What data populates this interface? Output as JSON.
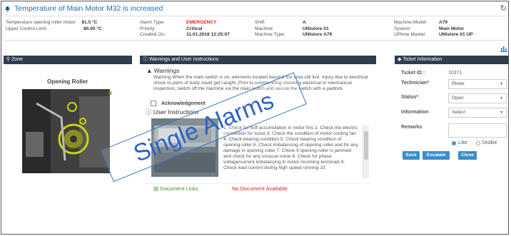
{
  "header": {
    "title": "Temperature of Main Motor M32 is increased"
  },
  "info": {
    "col1": [
      {
        "label": "Temperature opening roller motor:",
        "value": "81.5 °C"
      },
      {
        "label": "Upper Control Limit:",
        "value": "80.00  °C"
      }
    ],
    "col2": [
      {
        "label": "Alarm Type:",
        "value": "EMERGENCY"
      },
      {
        "label": "Priority:",
        "value": "Critical"
      },
      {
        "label": "Created On:",
        "value": "11.01.2018 12:25:07"
      }
    ],
    "col3": [
      {
        "label": "Shift:",
        "value": "A"
      },
      {
        "label": "Machine:",
        "value": "UNIstore 01"
      },
      {
        "label": "Machine Type:",
        "value": "UNIstore A79"
      }
    ],
    "col4": [
      {
        "label": "Machine Model:",
        "value": "A79"
      },
      {
        "label": "System:",
        "value": "Main Motor"
      },
      {
        "label": "UPtime Master:",
        "value": "UNIstore 01 UP"
      }
    ]
  },
  "panels": {
    "zone": "Zone",
    "warnings": "Warnings and User Instructions",
    "ticket": "Ticket Information"
  },
  "zone": {
    "title": "Opening Roller"
  },
  "warnings": {
    "title": "Warnings",
    "text": "Warning When the main switch is on, elements located beyond the area still live. Injury due to electrical shock or parts of body could get caught. Prior to commencing checking electrical or mechanical inspection, switch off the machine via the main switch and secure the switch with a padlock",
    "ack": "Acknowledgement",
    "ui_title": "User Instructions",
    "ui_text": "1. Check for fluff accumulation in motor fins 2. Check the electric connection for loose 3. Check the condition of motor cooling fan 4. Check bearing condition 5. Check bearing condition of opening roller 6. Check imbalancing of opening roller and for any damage in opening roller 7. Check if opening roller is jammed and check for any unusual noise 8. Check for phase voltage/current imbalancing in motor incoming terminals 9. Check load current during high speed running 10.",
    "doc_label": "Document Links",
    "doc_value": "No Document Available"
  },
  "ticket": {
    "ticket_id_label": "Ticket ID :",
    "ticket_id": "10371",
    "technician_label": "Technician",
    "technician": "Rieter",
    "status_label": "Status",
    "status": "Open",
    "information_label": "Information",
    "information": "Select",
    "remarks_label": "Remarks",
    "like": "Like",
    "dislike": "Dislike",
    "save": "Save",
    "escalate": "Escalate",
    "close": "Close"
  },
  "stamp": "Single Alarms",
  "colors": {
    "accent": "#1f6fb3",
    "panel": "#2f3d4c",
    "danger": "#e02020",
    "button": "#3a8ec8"
  }
}
